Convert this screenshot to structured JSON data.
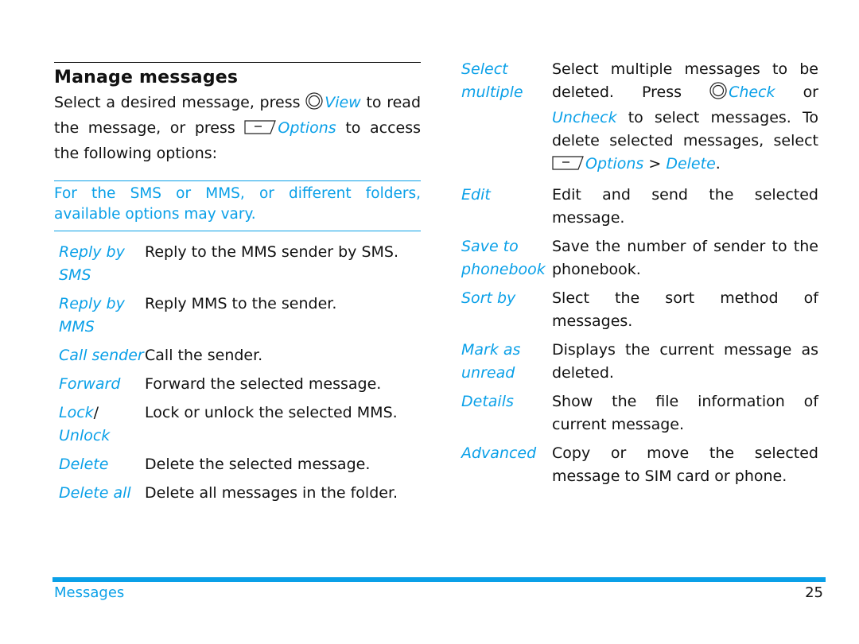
{
  "section": {
    "title": "Manage messages",
    "intro": {
      "part1": "Select a desired message, press",
      "view_label": "View",
      "part2": "to read the message, or press",
      "options_label": "Options",
      "part3": "to access the following options:"
    },
    "note": {
      "line1": "For the SMS or MMS, or different folders,",
      "line2": "available options may vary."
    }
  },
  "left_options": [
    {
      "key": "Reply by SMS",
      "desc": "Reply to the MMS sender by SMS."
    },
    {
      "key": "Reply by MMS",
      "desc": "Reply MMS to the sender."
    },
    {
      "key": "Call sender",
      "desc": "Call the sender."
    },
    {
      "key": "Forward",
      "desc": "Forward the selected message."
    },
    {
      "key_a": "Lock",
      "key_sep": "/",
      "key_b": "Unlock",
      "desc": "Lock or unlock the selected MMS."
    },
    {
      "key": "Delete",
      "desc": "Delete the selected message."
    },
    {
      "key": "Delete all",
      "desc": "Delete all messages in the folder."
    }
  ],
  "right_options": [
    {
      "key": "Select multiple",
      "desc_part1": "Select multiple messages to be deleted. Press",
      "check_label": "Check",
      "or_text": "or",
      "uncheck_label": "Uncheck",
      "desc_part2": "to select messages. To delete selected messages, select",
      "options_label": "Options",
      "gt": ">",
      "delete_label": "Delete",
      "period": "."
    },
    {
      "key": "Edit",
      "desc": "Edit and send the selected message."
    },
    {
      "key": "Save to phonebook",
      "desc": "Save the number of sender to the phonebook."
    },
    {
      "key": "Sort by",
      "desc": "Slect the sort method of messages."
    },
    {
      "key": "Mark as unread",
      "desc": "Displays the current message as deleted."
    },
    {
      "key": "Details",
      "desc": "Show the file information of current message."
    },
    {
      "key": "Advanced",
      "desc": "Copy or move the selected message to SIM card or phone."
    }
  ],
  "footer": {
    "chapter": "Messages",
    "page_number": "25"
  },
  "colors": {
    "accent": "#0aa0e8",
    "text": "#111111"
  }
}
